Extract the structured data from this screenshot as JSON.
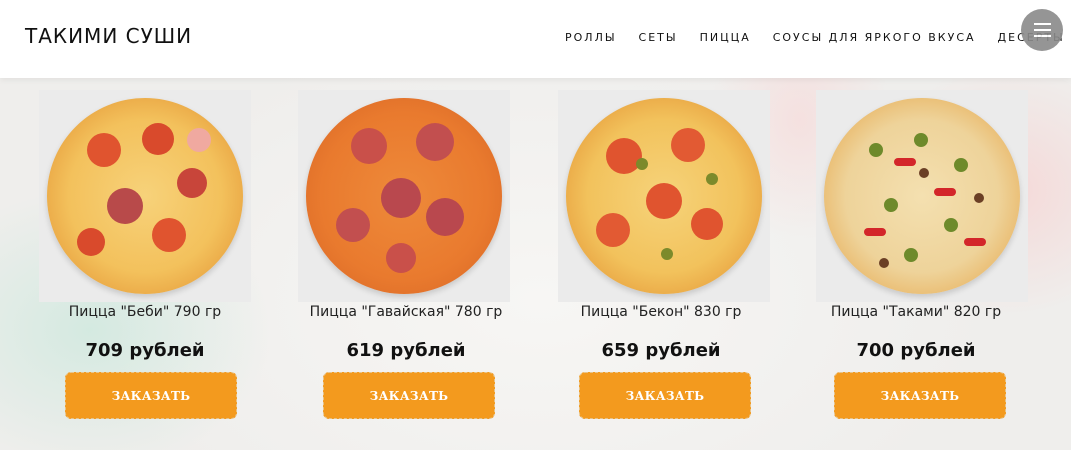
{
  "header": {
    "logo": "ТАКИМИ СУШИ",
    "nav": [
      "РОЛЛЫ",
      "СЕТЫ",
      "ПИЦЦА",
      "СОУСЫ ДЛЯ ЯРКОГО ВКУСА",
      "ДЕСЕРТЫ"
    ],
    "menu_icon": "hamburger-icon"
  },
  "products": [
    {
      "title": "Пицца \"Беби\" 790 гр",
      "price": "709 рублей",
      "button": "ЗАКАЗАТЬ"
    },
    {
      "title": "Пицца \"Гавайская\" 780 гр",
      "price": "619 рублей",
      "button": "ЗАКАЗАТЬ"
    },
    {
      "title": "Пицца \"Бекон\" 830 гр",
      "price": "659 рублей",
      "button": "ЗАКАЗАТЬ"
    },
    {
      "title": "Пицца \"Таками\" 820 гр",
      "price": "700 рублей",
      "button": "ЗАКАЗАТЬ"
    }
  ],
  "colors": {
    "accent": "#f39a1e",
    "header_bg": "#ffffff",
    "menu_button": "#8a8a8a"
  }
}
